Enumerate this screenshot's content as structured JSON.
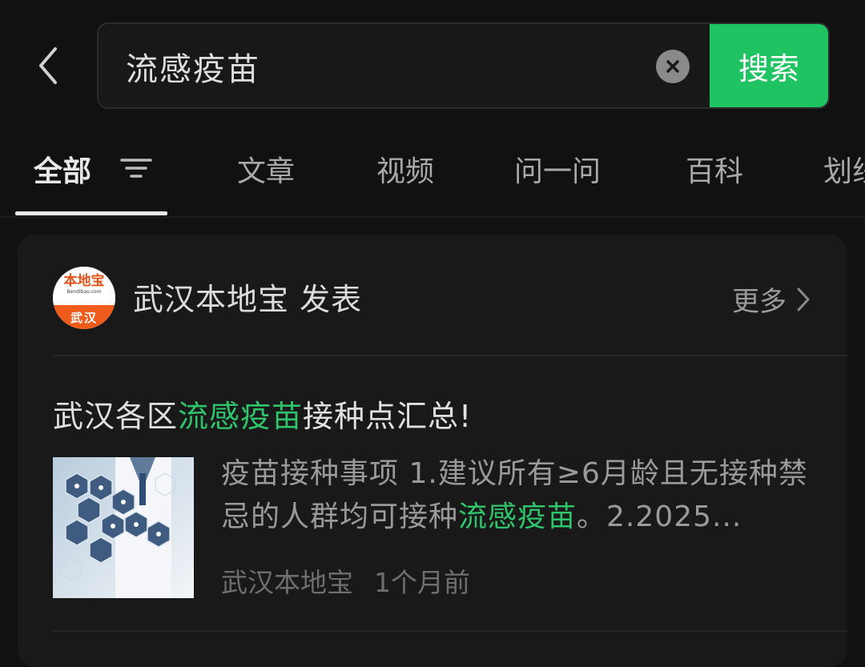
{
  "search": {
    "query": "流感疫苗",
    "button_label": "搜索"
  },
  "tabs": [
    {
      "label": "全部",
      "active": true
    },
    {
      "label": "文章"
    },
    {
      "label": "视频"
    },
    {
      "label": "问一问"
    },
    {
      "label": "百科"
    },
    {
      "label": "划线"
    }
  ],
  "card": {
    "avatar": {
      "brand": "本地宝",
      "domain": "Bendibao.com",
      "city": "武汉"
    },
    "publisher": "武汉本地宝 发表",
    "more_label": "更多",
    "article": {
      "title_before": "武汉各区",
      "title_highlight": "流感疫苗",
      "title_after": "接种点汇总!",
      "snippet_before": "疫苗接种事项 1.建议所有≥6月龄且无接种禁忌的人群均可接种",
      "snippet_highlight": "流感疫苗",
      "snippet_after": "。2.2025...",
      "source": "武汉本地宝",
      "time": "1个月前"
    }
  },
  "colors": {
    "accent": "#1fc361",
    "highlight": "#2fc46b",
    "background": "#111111",
    "card": "#191919"
  },
  "icons": [
    "back-icon",
    "clear-icon",
    "filter-icon",
    "chevron-right-icon"
  ]
}
